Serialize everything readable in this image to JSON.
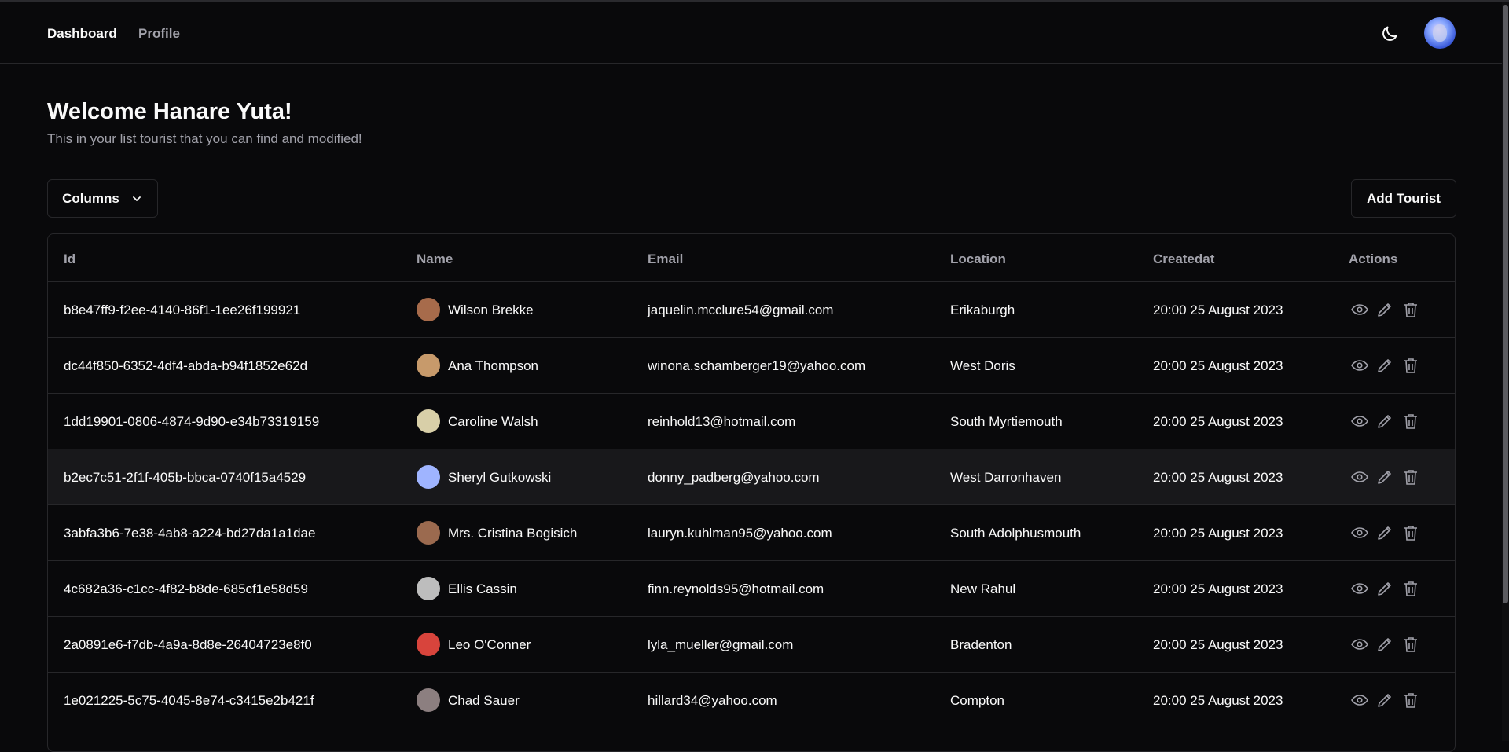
{
  "nav": {
    "dashboard": "Dashboard",
    "profile": "Profile"
  },
  "header": {
    "welcome": "Welcome Hanare Yuta!",
    "subtitle": "This in your list tourist that you can find and modified!"
  },
  "toolbar": {
    "columns_label": "Columns",
    "add_label": "Add Tourist"
  },
  "table": {
    "headers": [
      "Id",
      "Name",
      "Email",
      "Location",
      "Createdat",
      "Actions"
    ],
    "rows": [
      {
        "id": "b8e47ff9-f2ee-4140-86f1-1ee26f199921",
        "name": "Wilson Brekke",
        "email": "jaquelin.mcclure54@gmail.com",
        "location": "Erikaburgh",
        "createdat": "20:00 25 August 2023",
        "avatar_color": "#a76b4b"
      },
      {
        "id": "dc44f850-6352-4df4-abda-b94f1852e62d",
        "name": "Ana Thompson",
        "email": "winona.schamberger19@yahoo.com",
        "location": "West Doris",
        "createdat": "20:00 25 August 2023",
        "avatar_color": "#c79a6b"
      },
      {
        "id": "1dd19901-0806-4874-9d90-e34b73319159",
        "name": "Caroline Walsh",
        "email": "reinhold13@hotmail.com",
        "location": "South Myrtiemouth",
        "createdat": "20:00 25 August 2023",
        "avatar_color": "#d8cfa8"
      },
      {
        "id": "b2ec7c51-2f1f-405b-bbca-0740f15a4529",
        "name": "Sheryl Gutkowski",
        "email": "donny_padberg@yahoo.com",
        "location": "West Darronhaven",
        "createdat": "20:00 25 August 2023",
        "avatar_color": "#9fb4ff"
      },
      {
        "id": "3abfa3b6-7e38-4ab8-a224-bd27da1a1dae",
        "name": "Mrs. Cristina Bogisich",
        "email": "lauryn.kuhlman95@yahoo.com",
        "location": "South Adolphusmouth",
        "createdat": "20:00 25 August 2023",
        "avatar_color": "#9b6a4f"
      },
      {
        "id": "4c682a36-c1cc-4f82-b8de-685cf1e58d59",
        "name": "Ellis Cassin",
        "email": "finn.reynolds95@hotmail.com",
        "location": "New Rahul",
        "createdat": "20:00 25 August 2023",
        "avatar_color": "#bdbdbd"
      },
      {
        "id": "2a0891e6-f7db-4a9a-8d8e-26404723e8f0",
        "name": "Leo O'Conner",
        "email": "lyla_mueller@gmail.com",
        "location": "Bradenton",
        "createdat": "20:00 25 August 2023",
        "avatar_color": "#d8443c"
      },
      {
        "id": "1e021225-5c75-4045-8e74-c3415e2b421f",
        "name": "Chad Sauer",
        "email": "hillard34@yahoo.com",
        "location": "Compton",
        "createdat": "20:00 25 August 2023",
        "avatar_color": "#8c7f80"
      }
    ]
  },
  "icons": {
    "theme": "moon-icon",
    "columns": "chevron-down-icon",
    "view": "eye-icon",
    "edit": "pencil-icon",
    "delete": "trash-icon"
  },
  "colors": {
    "background": "#09090b",
    "border": "#27272a",
    "muted_text": "#a1a1aa",
    "text": "#fafafa",
    "row_hover": "#18181b"
  }
}
